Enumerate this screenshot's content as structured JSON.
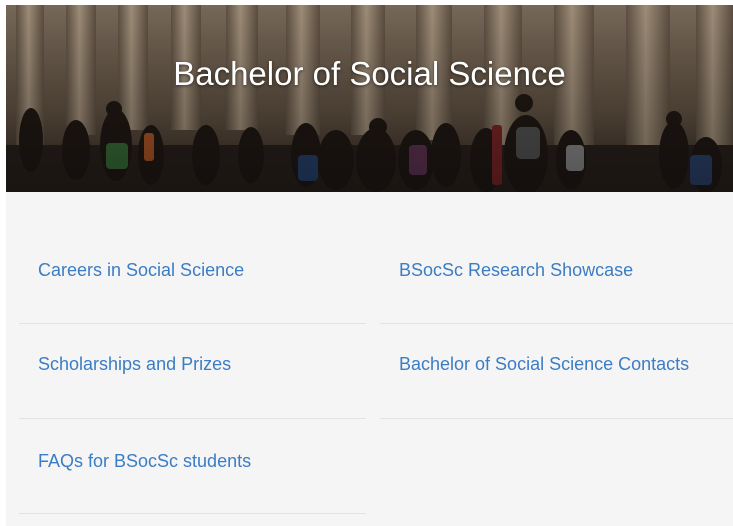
{
  "hero": {
    "title": "Bachelor of Social Science"
  },
  "links": [
    {
      "label": "Careers in Social Science"
    },
    {
      "label": "BSocSc Research Showcase"
    },
    {
      "label": "Scholarships and Prizes"
    },
    {
      "label": "Bachelor of Social Science Contacts"
    },
    {
      "label": "FAQs for BSocSc students"
    }
  ],
  "colors": {
    "link": "#3b7dc4",
    "panel_background": "#f5f5f5",
    "divider": "#e3e3e3",
    "hero_text": "#ffffff"
  }
}
